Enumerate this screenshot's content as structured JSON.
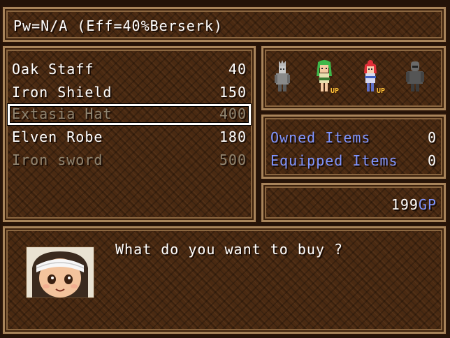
{
  "help": {
    "text": "Pw=N/A (Eff=40%Berserk)"
  },
  "items": [
    {
      "name": "Oak Staff",
      "price": "40",
      "available": true
    },
    {
      "name": "Iron Shield",
      "price": "150",
      "available": true
    },
    {
      "name": "Extasia Hat",
      "price": "400",
      "available": false,
      "selected": true
    },
    {
      "name": "Elven Robe",
      "price": "180",
      "available": true
    },
    {
      "name": "Iron sword",
      "price": "500",
      "available": false
    }
  ],
  "party": {
    "members": [
      {
        "icon": "gray-warrior-sprite",
        "status": ""
      },
      {
        "icon": "green-hair-girl-sprite",
        "status": "UP"
      },
      {
        "icon": "red-hair-girl-sprite",
        "status": "UP"
      },
      {
        "icon": "dark-knight-sprite",
        "status": ""
      }
    ]
  },
  "stats": {
    "owned_label": "Owned Items",
    "owned_value": "0",
    "equipped_label": "Equipped Items",
    "equipped_value": "0"
  },
  "gold": {
    "amount": "199",
    "unit": "GP"
  },
  "dialog": {
    "message": "What do you want to buy ?",
    "portrait": "shopkeeper-portrait"
  },
  "colors": {
    "window": "#4a2a12",
    "border": "#a8845a",
    "highlight_text": "#7f95ff",
    "disabled_text": "#8f8470",
    "up_badge": "#ffc23a"
  }
}
